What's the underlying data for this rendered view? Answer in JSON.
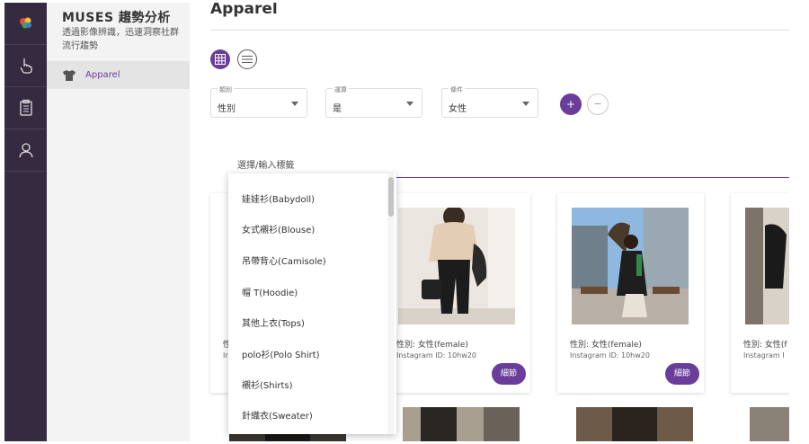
{
  "app": {
    "brand": "MUSES 趨勢分析",
    "brand_sub": "透過影像辨識，迅速洞察社群流行趨勢"
  },
  "rail": {
    "icons": [
      "logo-icon",
      "hand-pointer-icon",
      "clipboard-icon",
      "user-icon"
    ]
  },
  "sidenav": {
    "items": [
      {
        "label": "Apparel",
        "icon": "tshirt-icon"
      }
    ]
  },
  "main": {
    "title": "Apparel",
    "filters": [
      {
        "caption": "類別",
        "value": "性別"
      },
      {
        "caption": "運算",
        "value": "是"
      },
      {
        "caption": "條件",
        "value": "女性"
      }
    ],
    "add_label": "+",
    "remove_label": "−",
    "tag_label": "選擇/輸入標籤"
  },
  "dropdown": {
    "options": [
      "娃娃衫(Babydoll)",
      "女式襯衫(Blouse)",
      "吊帶背心(Camisole)",
      "帽 T(Hoodie)",
      "其他上衣(Tops)",
      "polo衫(Polo Shirt)",
      "襯衫(Shirts)",
      "針織衣(Sweater)"
    ]
  },
  "cards": [
    {
      "gender": "性別: 女性(female)",
      "ig": "Instagram ID: 10hw20",
      "detail": "細節"
    },
    {
      "gender": "性別: 女性(female)",
      "ig": "Instagram ID: 10hw20",
      "detail": "細節"
    },
    {
      "gender": "性別: 女性(f",
      "ig": "Instagram I",
      "detail": ""
    }
  ],
  "colors": {
    "accent": "#6a3d9a",
    "rail": "#352a40"
  }
}
